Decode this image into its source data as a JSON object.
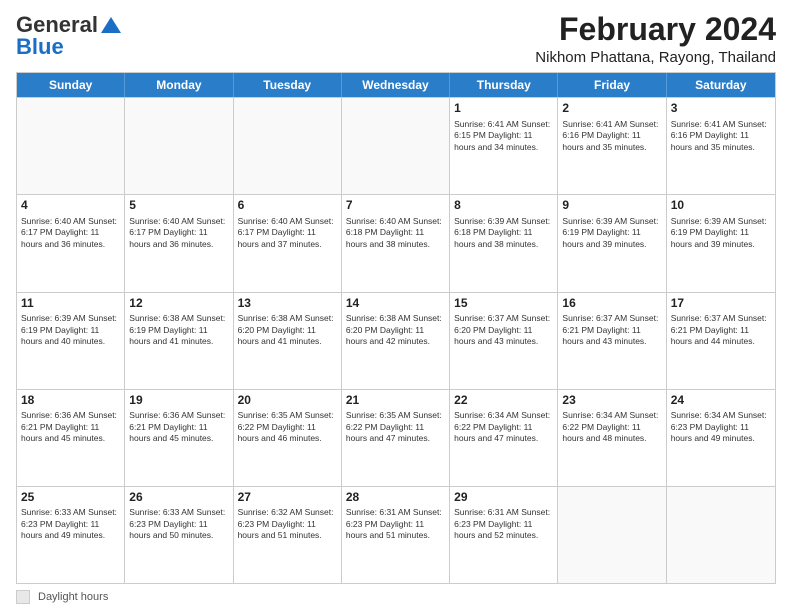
{
  "header": {
    "logo_general": "General",
    "logo_blue": "Blue",
    "main_title": "February 2024",
    "sub_title": "Nikhom Phattana, Rayong, Thailand"
  },
  "calendar": {
    "days_of_week": [
      "Sunday",
      "Monday",
      "Tuesday",
      "Wednesday",
      "Thursday",
      "Friday",
      "Saturday"
    ],
    "weeks": [
      [
        {
          "day": "",
          "info": ""
        },
        {
          "day": "",
          "info": ""
        },
        {
          "day": "",
          "info": ""
        },
        {
          "day": "",
          "info": ""
        },
        {
          "day": "1",
          "info": "Sunrise: 6:41 AM\nSunset: 6:15 PM\nDaylight: 11 hours and 34 minutes."
        },
        {
          "day": "2",
          "info": "Sunrise: 6:41 AM\nSunset: 6:16 PM\nDaylight: 11 hours and 35 minutes."
        },
        {
          "day": "3",
          "info": "Sunrise: 6:41 AM\nSunset: 6:16 PM\nDaylight: 11 hours and 35 minutes."
        }
      ],
      [
        {
          "day": "4",
          "info": "Sunrise: 6:40 AM\nSunset: 6:17 PM\nDaylight: 11 hours and 36 minutes."
        },
        {
          "day": "5",
          "info": "Sunrise: 6:40 AM\nSunset: 6:17 PM\nDaylight: 11 hours and 36 minutes."
        },
        {
          "day": "6",
          "info": "Sunrise: 6:40 AM\nSunset: 6:17 PM\nDaylight: 11 hours and 37 minutes."
        },
        {
          "day": "7",
          "info": "Sunrise: 6:40 AM\nSunset: 6:18 PM\nDaylight: 11 hours and 38 minutes."
        },
        {
          "day": "8",
          "info": "Sunrise: 6:39 AM\nSunset: 6:18 PM\nDaylight: 11 hours and 38 minutes."
        },
        {
          "day": "9",
          "info": "Sunrise: 6:39 AM\nSunset: 6:19 PM\nDaylight: 11 hours and 39 minutes."
        },
        {
          "day": "10",
          "info": "Sunrise: 6:39 AM\nSunset: 6:19 PM\nDaylight: 11 hours and 39 minutes."
        }
      ],
      [
        {
          "day": "11",
          "info": "Sunrise: 6:39 AM\nSunset: 6:19 PM\nDaylight: 11 hours and 40 minutes."
        },
        {
          "day": "12",
          "info": "Sunrise: 6:38 AM\nSunset: 6:19 PM\nDaylight: 11 hours and 41 minutes."
        },
        {
          "day": "13",
          "info": "Sunrise: 6:38 AM\nSunset: 6:20 PM\nDaylight: 11 hours and 41 minutes."
        },
        {
          "day": "14",
          "info": "Sunrise: 6:38 AM\nSunset: 6:20 PM\nDaylight: 11 hours and 42 minutes."
        },
        {
          "day": "15",
          "info": "Sunrise: 6:37 AM\nSunset: 6:20 PM\nDaylight: 11 hours and 43 minutes."
        },
        {
          "day": "16",
          "info": "Sunrise: 6:37 AM\nSunset: 6:21 PM\nDaylight: 11 hours and 43 minutes."
        },
        {
          "day": "17",
          "info": "Sunrise: 6:37 AM\nSunset: 6:21 PM\nDaylight: 11 hours and 44 minutes."
        }
      ],
      [
        {
          "day": "18",
          "info": "Sunrise: 6:36 AM\nSunset: 6:21 PM\nDaylight: 11 hours and 45 minutes."
        },
        {
          "day": "19",
          "info": "Sunrise: 6:36 AM\nSunset: 6:21 PM\nDaylight: 11 hours and 45 minutes."
        },
        {
          "day": "20",
          "info": "Sunrise: 6:35 AM\nSunset: 6:22 PM\nDaylight: 11 hours and 46 minutes."
        },
        {
          "day": "21",
          "info": "Sunrise: 6:35 AM\nSunset: 6:22 PM\nDaylight: 11 hours and 47 minutes."
        },
        {
          "day": "22",
          "info": "Sunrise: 6:34 AM\nSunset: 6:22 PM\nDaylight: 11 hours and 47 minutes."
        },
        {
          "day": "23",
          "info": "Sunrise: 6:34 AM\nSunset: 6:22 PM\nDaylight: 11 hours and 48 minutes."
        },
        {
          "day": "24",
          "info": "Sunrise: 6:34 AM\nSunset: 6:23 PM\nDaylight: 11 hours and 49 minutes."
        }
      ],
      [
        {
          "day": "25",
          "info": "Sunrise: 6:33 AM\nSunset: 6:23 PM\nDaylight: 11 hours and 49 minutes."
        },
        {
          "day": "26",
          "info": "Sunrise: 6:33 AM\nSunset: 6:23 PM\nDaylight: 11 hours and 50 minutes."
        },
        {
          "day": "27",
          "info": "Sunrise: 6:32 AM\nSunset: 6:23 PM\nDaylight: 11 hours and 51 minutes."
        },
        {
          "day": "28",
          "info": "Sunrise: 6:31 AM\nSunset: 6:23 PM\nDaylight: 11 hours and 51 minutes."
        },
        {
          "day": "29",
          "info": "Sunrise: 6:31 AM\nSunset: 6:23 PM\nDaylight: 11 hours and 52 minutes."
        },
        {
          "day": "",
          "info": ""
        },
        {
          "day": "",
          "info": ""
        }
      ]
    ]
  },
  "footer": {
    "legend_label": "Daylight hours"
  }
}
